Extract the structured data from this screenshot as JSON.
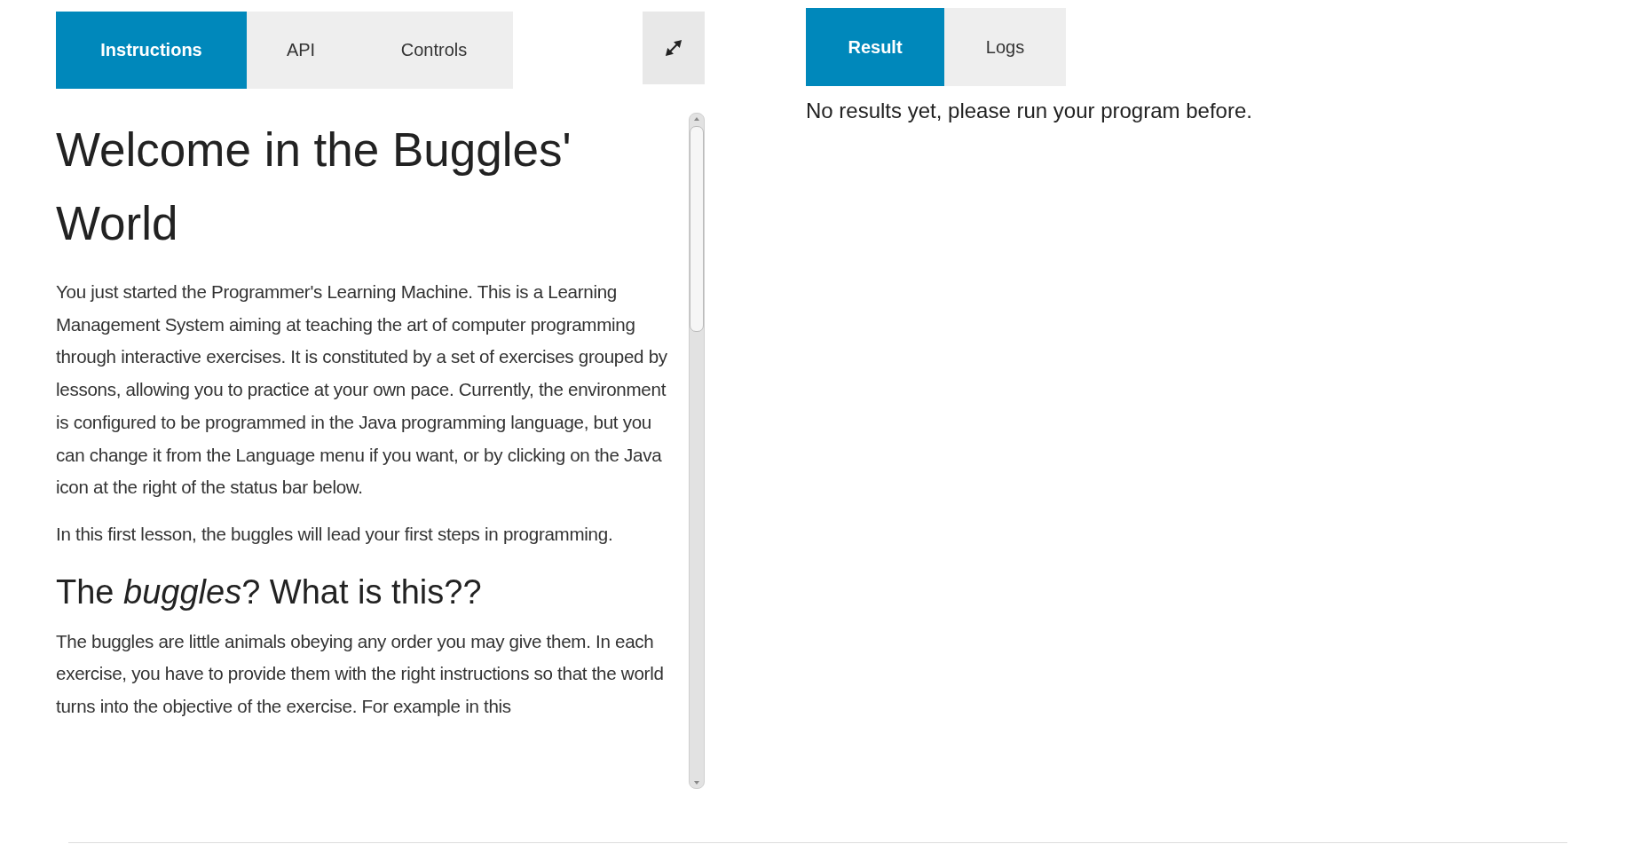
{
  "left_tabs": [
    {
      "label": "Instructions",
      "selected": true
    },
    {
      "label": "API",
      "selected": false
    },
    {
      "label": "Controls",
      "selected": false
    }
  ],
  "instructions": [
    {
      "kind": "h1",
      "text": "Welcome in the Buggles' World"
    },
    {
      "kind": "p",
      "text": "You just started the Programmer's Learning Machine. This is a Learning Management System aiming at teaching the art of computer programming through interactive exercises. It is constituted by a set of exercises grouped by lessons, allowing you to practice at your own pace. Currently, the environment is configured to be programmed in the Java programming language, but you can change it from the Language menu if you want, or by clicking on the Java icon at the right of the status bar below."
    },
    {
      "kind": "p",
      "text": "In this first lesson, the buggles will lead your first steps in programming."
    },
    {
      "kind": "h2",
      "text": "The *buggles*? What is this??"
    },
    {
      "kind": "p",
      "text": "The buggles are little animals obeying any order you may give them. In each exercise, you have to provide them with the right instructions so that the world turns into the objective of the exercise. For example in this"
    }
  ],
  "right_tabs": [
    {
      "label": "Result",
      "selected": true
    },
    {
      "label": "Logs",
      "selected": false
    }
  ],
  "result_message": "No results yet, please run your program before."
}
